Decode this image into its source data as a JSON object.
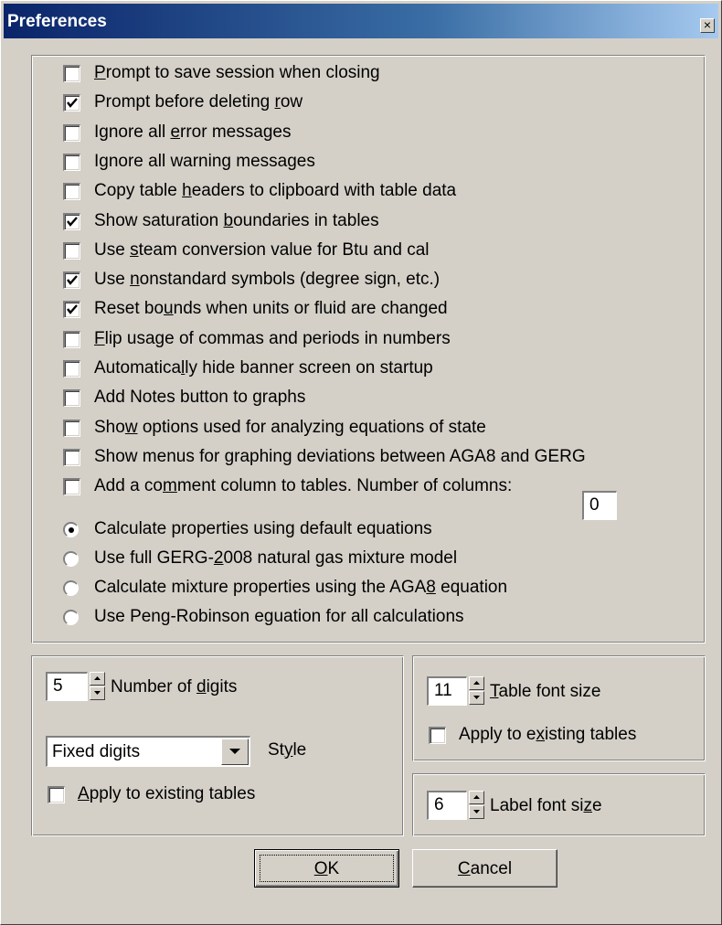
{
  "window": {
    "title": "Preferences",
    "close_glyph": "×"
  },
  "options": [
    {
      "pre": "",
      "key": "P",
      "post": "rompt to save session when closing",
      "checked": false
    },
    {
      "pre": "Prompt before deleting ",
      "key": "r",
      "post": "ow",
      "checked": true
    },
    {
      "pre": "Ignore all ",
      "key": "e",
      "post": "rror messages",
      "checked": false
    },
    {
      "pre": "Ignore all warnin",
      "key": "g",
      "post": " messages",
      "checked": false
    },
    {
      "pre": "Copy table ",
      "key": "h",
      "post": "eaders to clipboard with table data",
      "checked": false
    },
    {
      "pre": "Show saturation ",
      "key": "b",
      "post": "oundaries in tables",
      "checked": true
    },
    {
      "pre": "Use ",
      "key": "s",
      "post": "team conversion value for Btu and cal",
      "checked": false
    },
    {
      "pre": "Use ",
      "key": "n",
      "post": "onstandard symbols (degree sign, etc.)",
      "checked": true
    },
    {
      "pre": "Reset bo",
      "key": "u",
      "post": "nds when units or fluid are changed",
      "checked": true
    },
    {
      "pre": "",
      "key": "F",
      "post": "lip usage of commas and periods in numbers",
      "checked": false
    },
    {
      "pre": "Automatica",
      "key": "l",
      "post": "ly hide banner screen on startup",
      "checked": false
    },
    {
      "pre": "Add Notes button to graphs",
      "key": "",
      "post": "",
      "checked": false
    },
    {
      "pre": "Sho",
      "key": "w",
      "post": " options used for analyzing equations of state",
      "checked": false
    },
    {
      "pre": "Show menus for graphing deviations between AGA8 and GERG",
      "key": "",
      "post": "",
      "checked": false
    },
    {
      "pre": "Add a co",
      "key": "m",
      "post": "ment column to tables.  Number of columns:",
      "checked": false
    }
  ],
  "comment_columns_value": "0",
  "models": [
    {
      "pre": "Calculate properties using default equations",
      "key": "",
      "post": "",
      "selected": true
    },
    {
      "pre": "Use full GERG-",
      "key": "2",
      "post": "008 natural gas mixture model",
      "selected": false
    },
    {
      "pre": "Calculate mixture properties using the AGA",
      "key": "8",
      "post": " equation",
      "selected": false
    },
    {
      "pre": "Use Peng-Robinson eguation for all calculations",
      "key": "",
      "post": "",
      "selected": false
    }
  ],
  "digits": {
    "value": "5",
    "label_pre": "Number of ",
    "label_key": "d",
    "label_post": "igits",
    "style_value": "Fixed digits",
    "style_label_pre": "St",
    "style_label_key": "y",
    "style_label_post": "le",
    "apply_pre": "",
    "apply_key": "A",
    "apply_post": "pply to existing tables",
    "apply_checked": false
  },
  "table_font": {
    "value": "11",
    "label_pre": "",
    "label_key": "T",
    "label_post": "able font size",
    "apply_pre": "Apply to e",
    "apply_key": "x",
    "apply_post": "isting tables",
    "apply_checked": false
  },
  "label_font": {
    "value": "6",
    "label_pre": "Label font si",
    "label_key": "z",
    "label_post": "e"
  },
  "buttons": {
    "ok_pre": "",
    "ok_key": "O",
    "ok_post": "K",
    "cancel_pre": "",
    "cancel_key": "C",
    "cancel_post": "ancel"
  },
  "colors": {
    "titlebar_start": "#0a246a",
    "titlebar_end": "#a6caf0",
    "face": "#d4d0c8"
  }
}
